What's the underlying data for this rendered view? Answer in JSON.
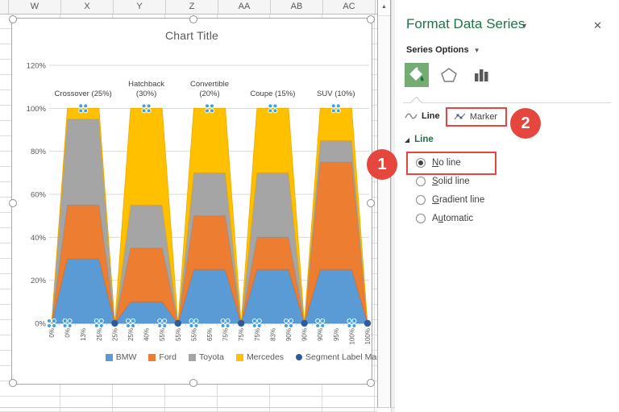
{
  "sheet": {
    "columns": [
      "W",
      "X",
      "Y",
      "Z",
      "AA",
      "AB",
      "AC"
    ],
    "scroll_up_icon": "▲"
  },
  "chart_data": {
    "type": "area",
    "subtype": "stacked-marimekko",
    "title": "Chart Title",
    "ylabel": "",
    "xlabel": "",
    "ylim": [
      0,
      120
    ],
    "grid": true,
    "legend_position": "bottom",
    "y_ticks": [
      "0%",
      "20%",
      "40%",
      "60%",
      "80%",
      "100%",
      "120%"
    ],
    "x_labels": [
      "0%",
      "0%",
      "13%",
      "25%",
      "25%",
      "25%",
      "40%",
      "55%",
      "55%",
      "55%",
      "65%",
      "75%",
      "75%",
      "75%",
      "83%",
      "90%",
      "90%",
      "90%",
      "95%",
      "100%",
      "100%"
    ],
    "series": [
      {
        "name": "BMW",
        "color": "#5B9BD5",
        "edge": "#4E8AC8",
        "values": [
          0,
          30,
          30,
          30,
          0,
          10,
          10,
          10,
          0,
          25,
          25,
          25,
          0,
          25,
          25,
          25,
          0,
          25,
          25,
          25,
          0
        ]
      },
      {
        "name": "Ford",
        "color": "#ED7D31",
        "edge": "#DD6E22",
        "values": [
          0,
          25,
          25,
          25,
          0,
          25,
          25,
          25,
          0,
          25,
          25,
          25,
          0,
          15,
          15,
          15,
          0,
          50,
          50,
          50,
          0
        ]
      },
      {
        "name": "Toyota",
        "color": "#A5A5A5",
        "edge": "#949494",
        "values": [
          0,
          40,
          40,
          40,
          0,
          20,
          20,
          20,
          0,
          20,
          20,
          20,
          0,
          30,
          30,
          30,
          0,
          10,
          10,
          10,
          0
        ]
      },
      {
        "name": "Mercedes",
        "color": "#FFC000",
        "edge": "#EDAD00",
        "values": [
          0,
          5,
          5,
          5,
          0,
          45,
          45,
          45,
          0,
          30,
          30,
          30,
          0,
          30,
          30,
          30,
          0,
          15,
          15,
          15,
          0
        ]
      }
    ],
    "marker_series": {
      "name": "Segment Label Marker",
      "color": "#2F5B9D",
      "highlight_color": "#3FA2E0",
      "top_points": [
        3,
        7,
        11,
        15,
        19
      ],
      "zero_dot_points": [
        5,
        9,
        13,
        17,
        21
      ],
      "zero_x_points": [
        1,
        2,
        4,
        6,
        8,
        10,
        12,
        14,
        16,
        18,
        20
      ]
    },
    "segment_labels": [
      {
        "lines": [
          "Crossover (25%)"
        ],
        "point": 3
      },
      {
        "lines": [
          "Hatchback",
          "(30%)"
        ],
        "point": 7
      },
      {
        "lines": [
          "Convertible",
          "(20%)"
        ],
        "point": 11
      },
      {
        "lines": [
          "Coupe (15%)"
        ],
        "point": 15
      },
      {
        "lines": [
          "SUV (10%)"
        ],
        "point": 19
      }
    ],
    "segments": [
      {
        "name": "Crossover",
        "share_pct": 25,
        "x_range": [
          0,
          25
        ],
        "values": {
          "BMW": 30,
          "Ford": 25,
          "Toyota": 40,
          "Mercedes": 5
        }
      },
      {
        "name": "Hatchback",
        "share_pct": 30,
        "x_range": [
          25,
          55
        ],
        "values": {
          "BMW": 10,
          "Ford": 25,
          "Toyota": 20,
          "Mercedes": 45
        }
      },
      {
        "name": "Convertible",
        "share_pct": 20,
        "x_range": [
          55,
          75
        ],
        "values": {
          "BMW": 25,
          "Ford": 25,
          "Toyota": 20,
          "Mercedes": 30
        }
      },
      {
        "name": "Coupe",
        "share_pct": 15,
        "x_range": [
          75,
          90
        ],
        "values": {
          "BMW": 25,
          "Ford": 15,
          "Toyota": 30,
          "Mercedes": 30
        }
      },
      {
        "name": "SUV",
        "share_pct": 10,
        "x_range": [
          90,
          100
        ],
        "values": {
          "BMW": 25,
          "Ford": 50,
          "Toyota": 10,
          "Mercedes": 15
        }
      }
    ]
  },
  "panel": {
    "title": "Format Data Series",
    "section": "Series Options",
    "tabs": [
      {
        "label": "Line",
        "active": true
      },
      {
        "label": "Marker",
        "active": false
      }
    ],
    "group": "Line",
    "line_options": [
      {
        "pre": "",
        "u": "N",
        "rest": "o line",
        "selected": true
      },
      {
        "pre": "",
        "u": "S",
        "rest": "olid line",
        "selected": false
      },
      {
        "pre": "",
        "u": "G",
        "rest": "radient line",
        "selected": false
      },
      {
        "pre": "A",
        "u": "u",
        "rest": "tomatic",
        "selected": false
      }
    ],
    "icons": {
      "dropdown": "▼",
      "close": "✕",
      "expand": "◢"
    },
    "accent_green": "#217346",
    "annotation_red": "#E5473E",
    "annotations": [
      {
        "n": "1",
        "target": "No line option"
      },
      {
        "n": "2",
        "target": "Marker tab"
      }
    ]
  }
}
